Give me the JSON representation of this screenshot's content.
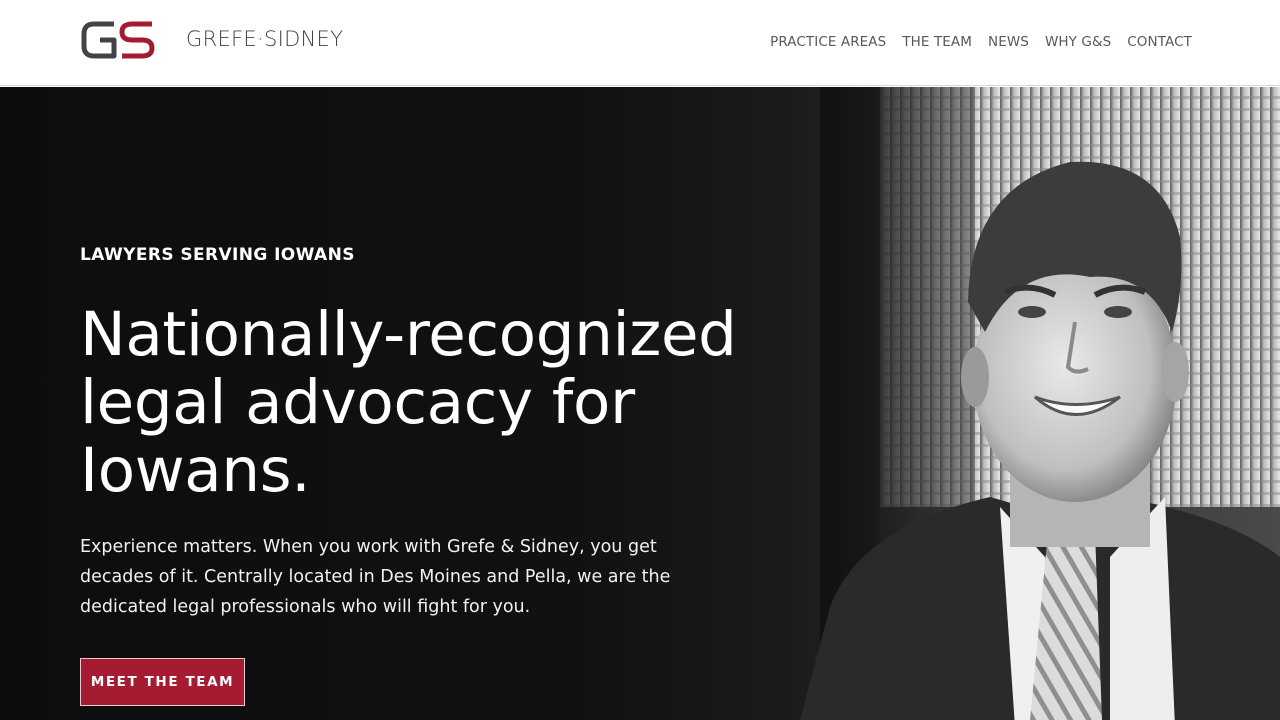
{
  "header": {
    "logo_initials": "GS",
    "logo_text": "GREFE·SIDNEY",
    "nav": [
      {
        "label": "PRACTICE AREAS"
      },
      {
        "label": "THE TEAM"
      },
      {
        "label": "NEWS"
      },
      {
        "label": "WHY G&S"
      },
      {
        "label": "CONTACT"
      }
    ]
  },
  "hero": {
    "eyebrow": "LAWYERS SERVING IOWANS",
    "headline": "Nationally-recognized legal advocacy for Iowans.",
    "body": "Experience matters. When you work with Grefe & Sidney, you get decades of it. Centrally located in Des Moines and Pella, we are the dedicated legal professionals who will fight for you.",
    "cta_label": "MEET THE TEAM",
    "photo_subject": "attorney-portrait"
  },
  "colors": {
    "brand_red": "#a51b31",
    "logo_gray": "#404448",
    "nav_text": "#555a60",
    "hero_bg": "#111111"
  }
}
